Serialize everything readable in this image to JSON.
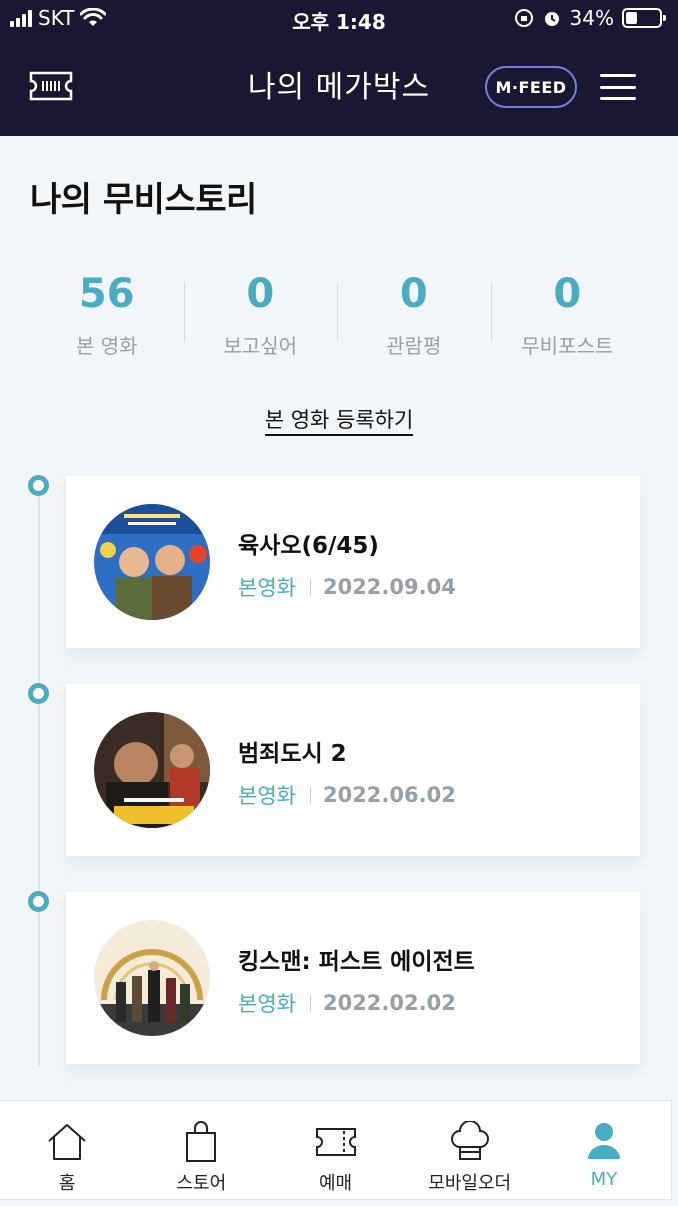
{
  "status_bar": {
    "carrier": "SKT",
    "time": "오후 1:48",
    "battery": "34%",
    "battery_level": 0.34
  },
  "header": {
    "title": "나의 메가박스",
    "mfeed_label": "M·FEED"
  },
  "page": {
    "title": "나의 무비스토리"
  },
  "stats": [
    {
      "value": "56",
      "label": "본 영화"
    },
    {
      "value": "0",
      "label": "보고싶어"
    },
    {
      "value": "0",
      "label": "관람평"
    },
    {
      "value": "0",
      "label": "무비포스트"
    }
  ],
  "register_link": "본 영화 등록하기",
  "movies": [
    {
      "title": "육사오(6/45)",
      "tag": "본영화",
      "date": "2022.09.04"
    },
    {
      "title": "범죄도시 2",
      "tag": "본영화",
      "date": "2022.06.02"
    },
    {
      "title": "킹스맨: 퍼스트 에이전트",
      "tag": "본영화",
      "date": "2022.02.02"
    }
  ],
  "bottom_nav": [
    {
      "label": "홈",
      "icon": "home-icon"
    },
    {
      "label": "스토어",
      "icon": "shopping-bag-icon"
    },
    {
      "label": "예매",
      "icon": "ticket-icon"
    },
    {
      "label": "모바일오더",
      "icon": "chef-hat-icon"
    },
    {
      "label": "MY",
      "icon": "user-icon",
      "active": true
    }
  ],
  "colors": {
    "accent": "#4aacc2",
    "header_bg": "#1a1733"
  }
}
